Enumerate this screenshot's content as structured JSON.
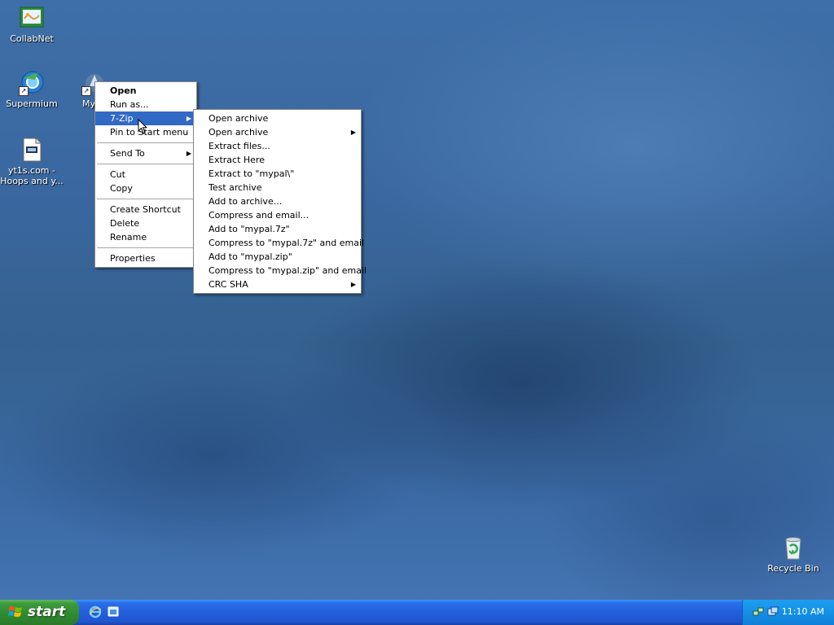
{
  "desktop": {
    "icons": [
      {
        "label": "CollabNet"
      },
      {
        "label": "Supermium"
      },
      {
        "label": "My"
      },
      {
        "label": "yt1s.com -\nHoops and y..."
      },
      {
        "label": "Recycle Bin"
      }
    ]
  },
  "context_menu": {
    "items": [
      {
        "label": "Open"
      },
      {
        "label": "Run as..."
      },
      {
        "label": "7-Zip"
      },
      {
        "label": "Pin to Start menu"
      },
      {
        "label": "Send To"
      },
      {
        "label": "Cut"
      },
      {
        "label": "Copy"
      },
      {
        "label": "Create Shortcut"
      },
      {
        "label": "Delete"
      },
      {
        "label": "Rename"
      },
      {
        "label": "Properties"
      }
    ]
  },
  "submenu_7zip": {
    "items": [
      {
        "label": "Open archive"
      },
      {
        "label": "Open archive"
      },
      {
        "label": "Extract files..."
      },
      {
        "label": "Extract Here"
      },
      {
        "label": "Extract to \"mypal\\\""
      },
      {
        "label": "Test archive"
      },
      {
        "label": "Add to archive..."
      },
      {
        "label": "Compress and email..."
      },
      {
        "label": "Add to \"mypal.7z\""
      },
      {
        "label": "Compress to \"mypal.7z\" and email"
      },
      {
        "label": "Add to \"mypal.zip\""
      },
      {
        "label": "Compress to \"mypal.zip\" and email"
      },
      {
        "label": "CRC SHA"
      }
    ]
  },
  "taskbar": {
    "start_label": "start",
    "clock": "11:10 AM"
  },
  "colors": {
    "menu_highlight": "#316ac5",
    "taskbar": "#245edb",
    "start_button": "#3c9a3c"
  }
}
